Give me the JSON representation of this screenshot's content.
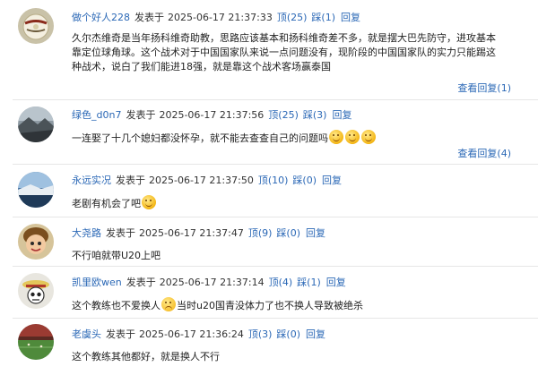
{
  "comments": [
    {
      "user": "做个好人228",
      "posted": "发表于",
      "time": "2025-06-17  21:37:33",
      "upvote": "顶(25)",
      "downvote": "踩(1)",
      "reply": "回复",
      "lines": [
        "久尔杰维奇是当年扬科维奇助教，思路应该基本和扬科维奇差不多，就是摆大巴先防守，进攻基本",
        "靠定位球角球。这个战术对于中国国家队来说一点问题没有，现阶段的中国国家队的实力只能踢这",
        "种战术，说白了我们能进18强，就是靠这个战术客场赢泰国"
      ],
      "view_replies": "查看回复(1)",
      "avatar_icon": "football-icon"
    },
    {
      "user": "绿色_d0n7",
      "posted": "发表于",
      "time": "2025-06-17  21:37:56",
      "upvote": "顶(25)",
      "downvote": "踩(3)",
      "reply": "回复",
      "text": "一连娶了十几个媳妇都没怀孕，就不能去查查自己的问题吗",
      "view_replies": "查看回复(4)",
      "avatar_icon": "landscape-icon"
    },
    {
      "user": "永远实况",
      "posted": "发表于",
      "time": "2025-06-17  21:37:50",
      "upvote": "顶(10)",
      "downvote": "踩(0)",
      "reply": "回复",
      "text": "老剧有机会了吧",
      "avatar_icon": "landscape-icon"
    },
    {
      "user": "大尧路",
      "posted": "发表于",
      "time": "2025-06-17  21:37:47",
      "upvote": "顶(9)",
      "downvote": "踩(0)",
      "reply": "回复",
      "text": "不行咱就带U20上吧",
      "avatar_icon": "child-face-icon"
    },
    {
      "user": "凯里欧wen",
      "posted": "发表于",
      "time": "2025-06-17  21:37:14",
      "upvote": "顶(4)",
      "downvote": "踩(1)",
      "reply": "回复",
      "text_before": "这个教练也不爱换人",
      "text_after": "当时u20国青没体力了也不换人导致被绝杀",
      "avatar_icon": "skull-icon"
    },
    {
      "user": "老虞头",
      "posted": "发表于",
      "time": "2025-06-17  21:36:24",
      "upvote": "顶(3)",
      "downvote": "踩(0)",
      "reply": "回复",
      "text": "这个教练其他都好，就是换人不行",
      "avatar_icon": "stadium-icon"
    }
  ],
  "colors": {
    "link": "#2b68b6",
    "text": "#222222",
    "separator": "#e6e6e6"
  }
}
